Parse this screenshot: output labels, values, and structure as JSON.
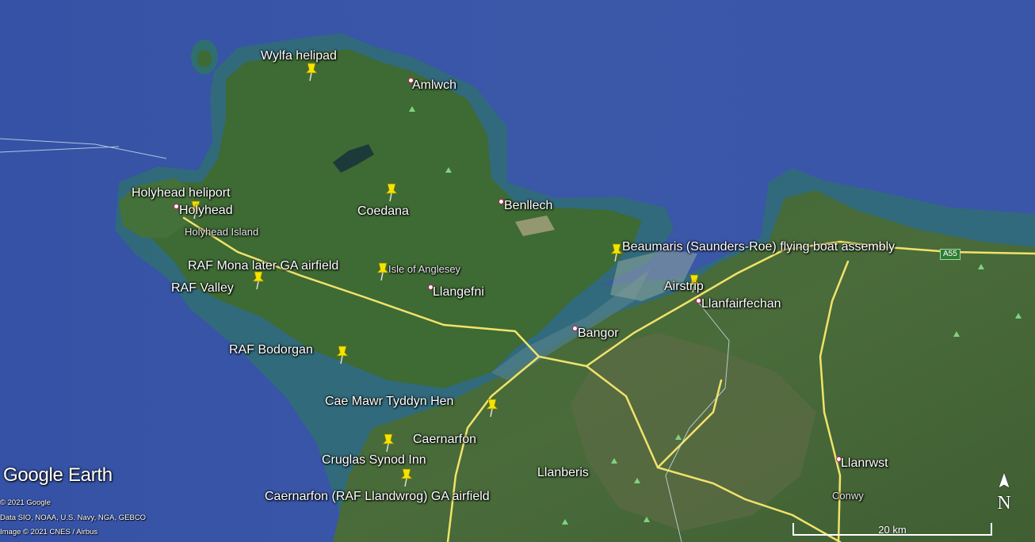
{
  "places": [
    {
      "id": "wylfa-helipad",
      "label": "Wylfa helipad"
    },
    {
      "id": "amlwch",
      "label": "Amlwch"
    },
    {
      "id": "holyhead-heliport",
      "label": "Holyhead heliport"
    },
    {
      "id": "holyhead",
      "label": "Holyhead"
    },
    {
      "id": "holyhead-island",
      "label": "Holyhead Island"
    },
    {
      "id": "coedana",
      "label": "Coedana"
    },
    {
      "id": "benllech",
      "label": "Benllech"
    },
    {
      "id": "beaumaris",
      "label": "Beaumaris (Saunders-Roe) flying boat assembly"
    },
    {
      "id": "raf-mona",
      "label": "RAF Mona later GA airfield"
    },
    {
      "id": "isle-of-anglesey",
      "label": "Isle of Anglesey"
    },
    {
      "id": "raf-valley",
      "label": "RAF Valley"
    },
    {
      "id": "llangefni",
      "label": "Llangefni"
    },
    {
      "id": "airstrip",
      "label": "Airstrip"
    },
    {
      "id": "llanfairfechan",
      "label": "Llanfairfechan"
    },
    {
      "id": "bangor",
      "label": "Bangor"
    },
    {
      "id": "raf-bodorgan",
      "label": "RAF Bodorgan"
    },
    {
      "id": "cae-mawr",
      "label": "Cae Mawr Tyddyn Hen"
    },
    {
      "id": "caernarfon",
      "label": "Caernarfon"
    },
    {
      "id": "cruglas",
      "label": "Cruglas Synod Inn"
    },
    {
      "id": "llanberis",
      "label": "Llanberis"
    },
    {
      "id": "llanrwst",
      "label": "Llanrwst"
    },
    {
      "id": "caernarfon-ga",
      "label": "Caernarfon (RAF Llandwrog) GA airfield"
    },
    {
      "id": "conwy",
      "label": "Conwy"
    }
  ],
  "road_shield": "A55",
  "branding": {
    "logo": "Google Earth",
    "copyright": "© 2021 Google",
    "data_credit": "Data SIO, NOAA, U.S. Navy, NGA, GEBCO",
    "image_credit": "Image © 2021 CNES / Airbus"
  },
  "scale_bar": {
    "label": "20 km"
  },
  "compass": {
    "label": "N"
  },
  "colors": {
    "sea": "#3a55a3",
    "land": "#3f6b34",
    "road": "#f1e36a",
    "pin": "#f5e400"
  }
}
